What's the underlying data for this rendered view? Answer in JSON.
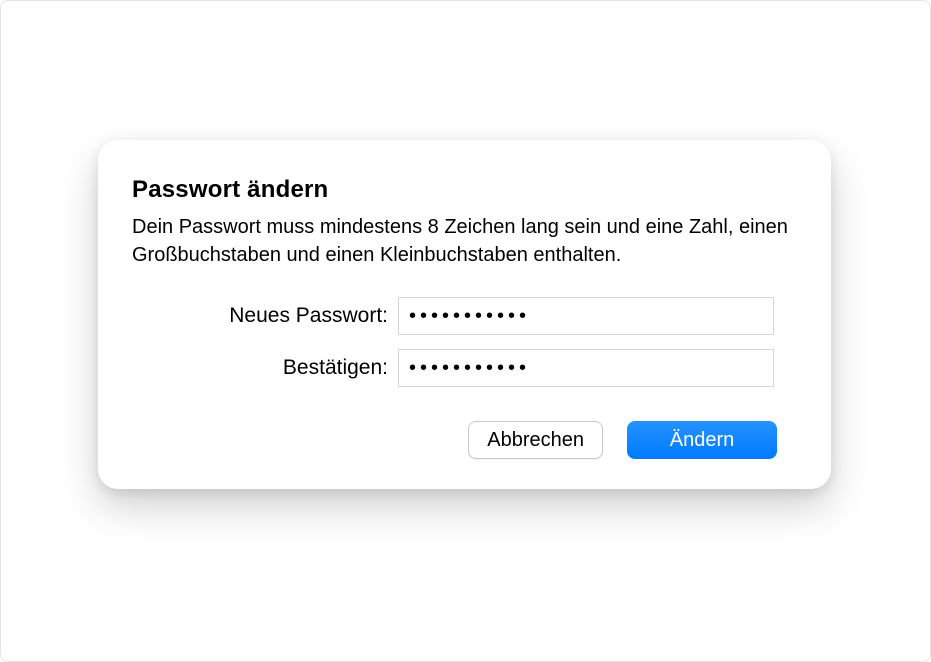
{
  "dialog": {
    "title": "Passwort ändern",
    "description": "Dein Passwort muss mindestens 8 Zeichen lang sein und eine Zahl, einen Großbuchstaben und einen Kleinbuchstaben enthalten.",
    "fields": {
      "new_password": {
        "label": "Neues Passwort:",
        "value": "•••••••••••"
      },
      "confirm": {
        "label": "Bestätigen:",
        "value": "•••••••••••"
      }
    },
    "buttons": {
      "cancel": "Abbrechen",
      "submit": "Ändern"
    }
  }
}
